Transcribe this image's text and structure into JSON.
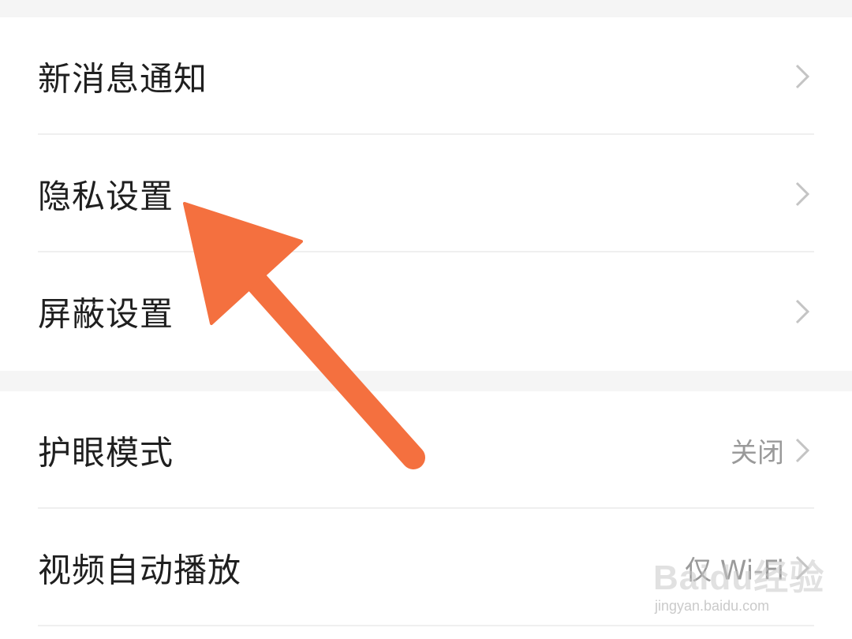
{
  "settings": {
    "group1": [
      {
        "label": "新消息通知",
        "value": ""
      },
      {
        "label": "隐私设置",
        "value": ""
      },
      {
        "label": "屏蔽设置",
        "value": ""
      }
    ],
    "group2": [
      {
        "label": "护眼模式",
        "value": "关闭"
      },
      {
        "label": "视频自动播放",
        "value": "仅 Wi-Fi"
      }
    ]
  },
  "annotation": {
    "arrow_color": "#f4703f",
    "icon": "arrow-pointing-icon"
  },
  "watermark": {
    "logo": "Baidu经验",
    "url": "jingyan.baidu.com"
  },
  "colors": {
    "background": "#f5f5f5",
    "card": "#ffffff",
    "label": "#1f1f1f",
    "value": "#9a9a9a",
    "chevron": "#c4c4c4"
  }
}
